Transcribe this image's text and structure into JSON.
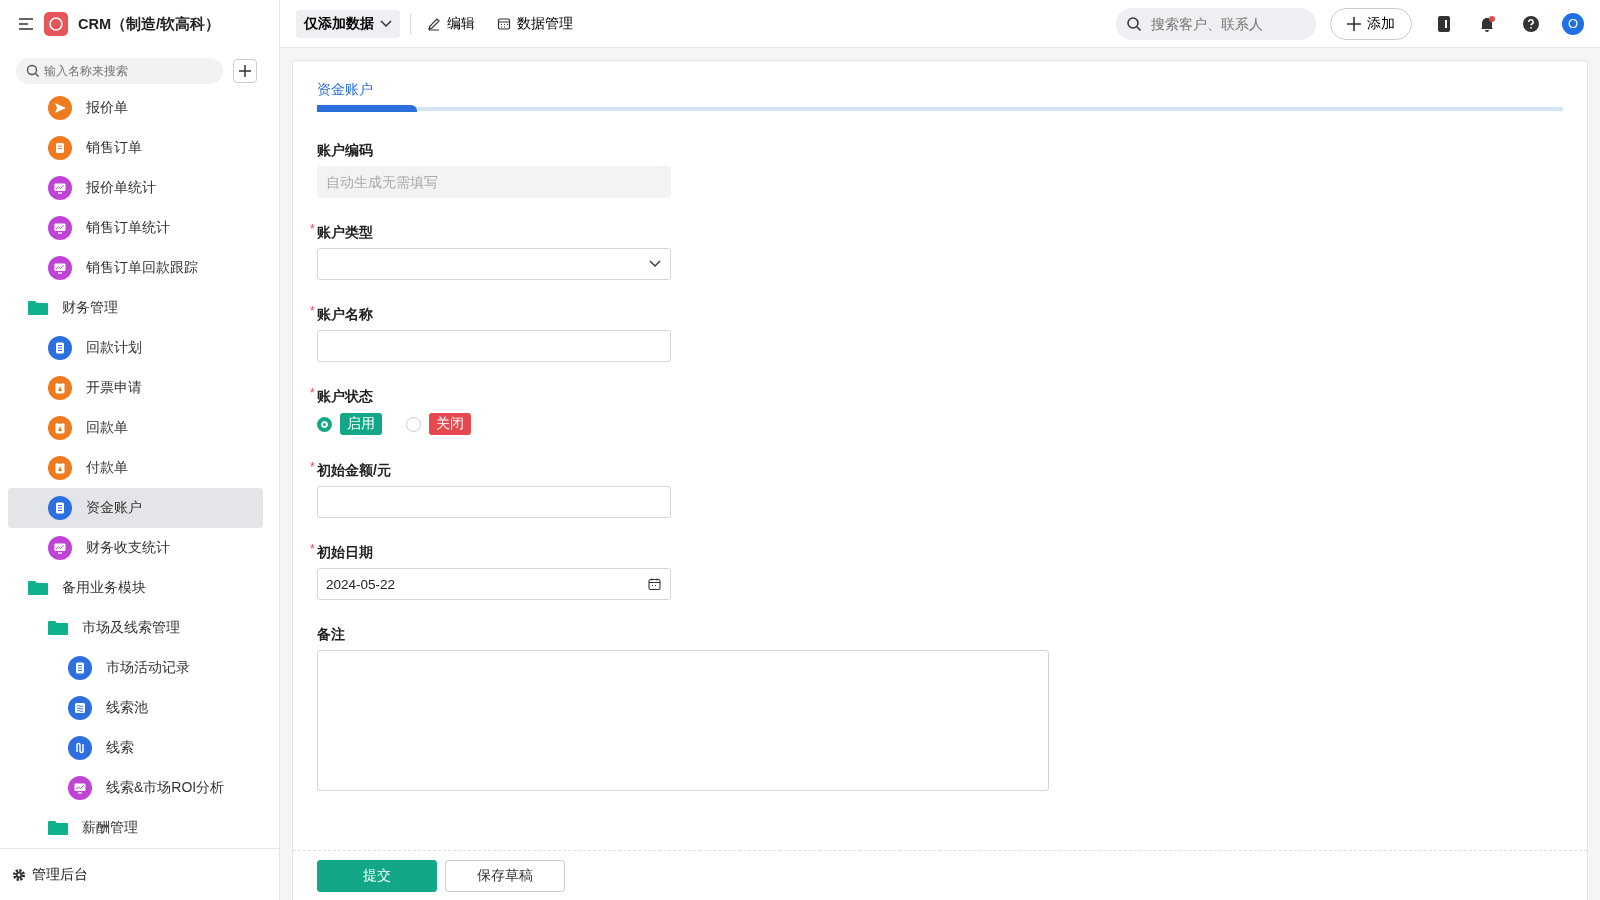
{
  "app": {
    "title": "CRM（制造/软高科）"
  },
  "sidebar": {
    "search": {
      "placeholder": "输入名称来搜索"
    },
    "items": [
      {
        "label": "报价单",
        "kind": "send",
        "selected": false
      },
      {
        "label": "销售订单",
        "kind": "form",
        "selected": false
      },
      {
        "label": "报价单统计",
        "kind": "chart",
        "selected": false
      },
      {
        "label": "销售订单统计",
        "kind": "chart",
        "selected": false
      },
      {
        "label": "销售订单回款跟踪",
        "kind": "chart",
        "selected": false
      },
      {
        "label": "财务管理",
        "kind": "folder",
        "children": [
          {
            "label": "回款计划",
            "kind": "doc",
            "selected": false
          },
          {
            "label": "开票申请",
            "kind": "clipboard",
            "selected": false
          },
          {
            "label": "回款单",
            "kind": "clipboard",
            "selected": false
          },
          {
            "label": "付款单",
            "kind": "clipboard",
            "selected": false
          },
          {
            "label": "资金账户",
            "kind": "doc",
            "selected": true
          },
          {
            "label": "财务收支统计",
            "kind": "chart",
            "selected": false
          }
        ]
      },
      {
        "label": "备用业务模块",
        "kind": "folder",
        "children": [
          {
            "label": "市场及线索管理",
            "kind": "folder",
            "children": [
              {
                "label": "市场活动记录",
                "kind": "doc",
                "selected": false
              },
              {
                "label": "线索池",
                "kind": "pool",
                "selected": false
              },
              {
                "label": "线索",
                "kind": "flow",
                "selected": false
              },
              {
                "label": "线索&市场ROI分析",
                "kind": "chart",
                "selected": false
              }
            ]
          },
          {
            "label": "薪酬管理",
            "kind": "folder"
          }
        ]
      }
    ],
    "footer": "管理后台"
  },
  "toolbar": {
    "mode": "仅添加数据",
    "edit": "编辑",
    "data_manage": "数据管理",
    "search": {
      "placeholder": "搜索客户、联系人"
    },
    "add": "添加",
    "avatar": "O",
    "has_notification": true
  },
  "tabs": [
    {
      "label": "资金账户",
      "selected": true
    }
  ],
  "form": {
    "fields": [
      {
        "kind": "readonly",
        "label": "账户编码",
        "placeholder": "自动生成无需填写"
      },
      {
        "kind": "select",
        "label": "账户类型",
        "mark": "*"
      },
      {
        "kind": "text",
        "label": "账户名称",
        "mark": "*"
      },
      {
        "kind": "radio",
        "label": "账户状态",
        "mark": "*",
        "options": [
          {
            "label": "启用",
            "selected": true,
            "color": "#12a887"
          },
          {
            "label": "关闭",
            "selected": false,
            "color": "#e5484d"
          }
        ]
      },
      {
        "kind": "text",
        "label": "初始金额/元",
        "mark": "*"
      },
      {
        "kind": "date",
        "label": "初始日期",
        "mark": "*",
        "value": "2024-05-22"
      },
      {
        "kind": "textarea",
        "label": "备注"
      }
    ],
    "buttons": [
      {
        "label": "提交",
        "kind": "primary"
      },
      {
        "label": "保存草稿",
        "kind": "secondary"
      }
    ]
  }
}
